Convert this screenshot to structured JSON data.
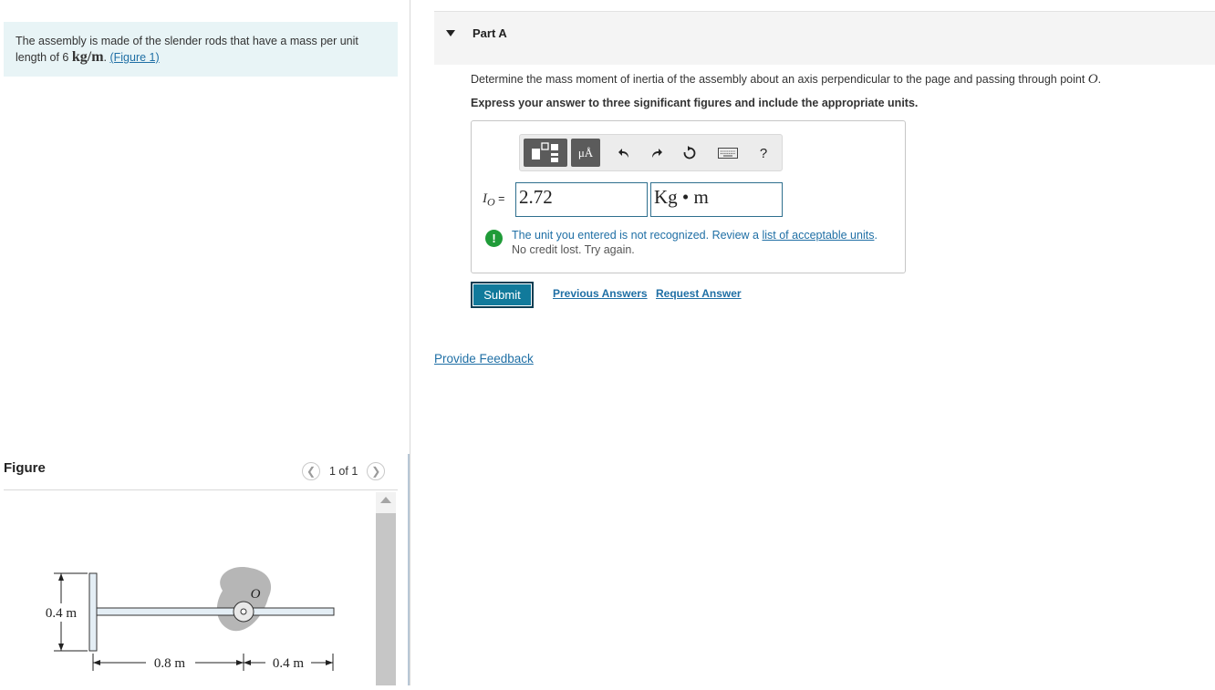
{
  "problem": {
    "text_before": "The assembly is made of the slender rods that have a mass per unit length of 6 ",
    "units": "kg/m",
    "sep": ". ",
    "figure_link": "(Figure 1)"
  },
  "figure_panel": {
    "title": "Figure",
    "pager_text": "1 of 1",
    "prev_icon": "chevron-left-icon",
    "next_icon": "chevron-right-icon",
    "diagram": {
      "label_04m_left": "0.4 m",
      "label_08m": "0.8 m",
      "label_04m_bottom": "0.4 m",
      "label_O": "O"
    }
  },
  "part": {
    "title": "Part A",
    "question_text": "Determine the mass moment of inertia of the assembly about an axis perpendicular to the page and passing through point ",
    "question_point": "O",
    "question_end": ".",
    "instruction": "Express your answer to three significant figures and include the appropriate units."
  },
  "toolbar": {
    "units_label": "μÅ",
    "undo_icon": "undo-icon",
    "redo_icon": "redo-icon",
    "reset_icon": "reset-icon",
    "keyboard_icon": "keyboard-icon",
    "help_label": "?"
  },
  "answer": {
    "symbol": "I",
    "subscript": "O",
    "equals": " =",
    "value": "2.72",
    "unit": "Kg • m"
  },
  "feedback_msg": {
    "text": "The unit you entered is not recognized. Review a ",
    "link": "list of acceptable units",
    "end": ".",
    "sub": "No credit lost. Try again."
  },
  "actions": {
    "submit": "Submit",
    "previous_answers": "Previous Answers",
    "request_answer": "Request Answer",
    "provide_feedback": "Provide Feedback"
  },
  "colors": {
    "accent": "#117a9b",
    "link": "#1f6fa5",
    "problem_bg": "#e8f4f6",
    "warning_icon": "#1f9b38"
  }
}
